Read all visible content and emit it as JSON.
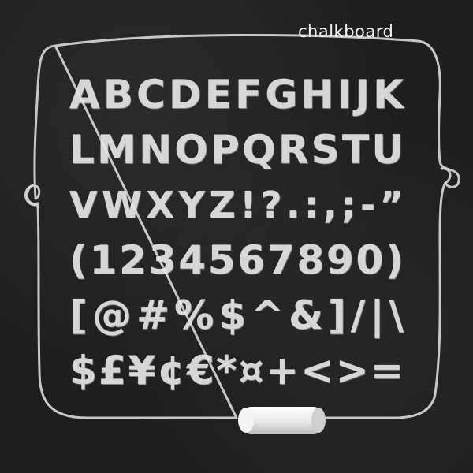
{
  "title": "chalkboard",
  "rows": [
    [
      "A",
      "B",
      "C",
      "D",
      "E",
      "F",
      "G",
      "H",
      "I",
      "J",
      "K"
    ],
    [
      "L",
      "M",
      "N",
      "O",
      "P",
      "Q",
      "R",
      "S",
      "T",
      "U"
    ],
    [
      "V",
      "W",
      "X",
      "Y",
      "Z",
      "!",
      "?",
      ".",
      ":",
      ",",
      ";",
      "-",
      "”"
    ],
    [
      "(",
      "1",
      "2",
      "3",
      "4",
      "5",
      "6",
      "7",
      "8",
      "9",
      "0",
      ")"
    ],
    [
      "[",
      "@",
      "#",
      "%",
      "$",
      "^",
      "&",
      "]",
      "/",
      "|",
      "\\"
    ],
    [
      "$",
      "£",
      "¥",
      "¢",
      "€",
      "*",
      "¤",
      "+",
      "<",
      ">",
      "="
    ]
  ],
  "colors": {
    "board": "#1e1e1e",
    "chalk": "#e6e6e6",
    "frame": "#d9d9d9"
  },
  "icons": [
    "chalk-stick-icon"
  ]
}
